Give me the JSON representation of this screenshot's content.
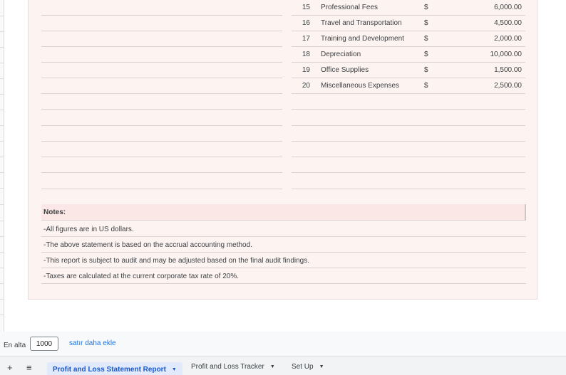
{
  "expenses": [
    {
      "num": "15",
      "label": "Professional Fees",
      "currency": "$",
      "amount": "6,000.00"
    },
    {
      "num": "16",
      "label": "Travel and Transportation",
      "currency": "$",
      "amount": "4,500.00"
    },
    {
      "num": "17",
      "label": "Training and Development",
      "currency": "$",
      "amount": "2,000.00"
    },
    {
      "num": "18",
      "label": "Depreciation",
      "currency": "$",
      "amount": "10,000.00"
    },
    {
      "num": "19",
      "label": "Office Supplies",
      "currency": "$",
      "amount": "1,500.00"
    },
    {
      "num": "20",
      "label": "Miscellaneous Expenses",
      "currency": "$",
      "amount": "2,500.00"
    }
  ],
  "notes": {
    "heading": "Notes:",
    "items": [
      "-All figures are in US dollars.",
      "-The above statement is based on the accrual accounting method.",
      "-This report is subject to audit and may be adjusted based on the final audit findings.",
      "-Taxes are calculated at the current corporate tax rate of 20%."
    ]
  },
  "add_rows": {
    "prefix": "En alta",
    "count": "1000",
    "link": "satır daha ekle"
  },
  "tabs": [
    {
      "label": "Profit and Loss Statement Report",
      "active": true
    },
    {
      "label": "Profit and Loss Tracker",
      "active": false
    },
    {
      "label": "Set Up",
      "active": false
    }
  ],
  "colors": {
    "report_bg": "#fdf4f2",
    "notes_header_bg": "#fbe7e5",
    "active_tab_text": "#1a57c9",
    "link": "#1a73e8"
  }
}
